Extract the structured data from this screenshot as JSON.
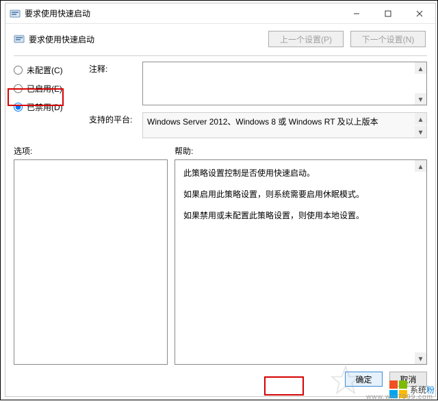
{
  "window": {
    "title": "要求使用快速启动",
    "min_tooltip": "最小化",
    "max_tooltip": "最大化",
    "close_tooltip": "关闭"
  },
  "header": {
    "policy_name": "要求使用快速启动",
    "prev_button": "上一个设置(P)",
    "next_button": "下一个设置(N)"
  },
  "radios": {
    "not_configured": "未配置(C)",
    "enabled": "已启用(E)",
    "disabled": "已禁用(D)",
    "selected": "disabled"
  },
  "comment": {
    "label": "注释:",
    "value": ""
  },
  "supported": {
    "label": "支持的平台:",
    "value": "Windows Server 2012、Windows 8 或 Windows RT 及以上版本"
  },
  "sections": {
    "options_label": "选项:",
    "help_label": "帮助:"
  },
  "help_text": [
    "此策略设置控制是否使用快速启动。",
    "如果启用此策略设置，则系统需要启用休眠模式。",
    "如果禁用或未配置此策略设置，则使用本地设置。"
  ],
  "buttons": {
    "ok": "确定",
    "cancel": "取消"
  },
  "watermark": {
    "text_a": "系统",
    "text_b": "粉",
    "url": "www.win7999.com"
  }
}
